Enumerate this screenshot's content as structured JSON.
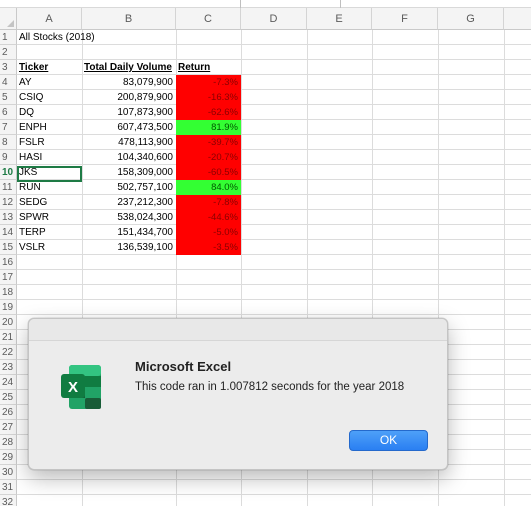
{
  "columns": [
    "A",
    "B",
    "C",
    "D",
    "E",
    "F",
    "G"
  ],
  "rows": [
    "1",
    "2",
    "3",
    "4",
    "5",
    "6",
    "7",
    "8",
    "9",
    "10",
    "11",
    "12",
    "13",
    "14",
    "15",
    "16",
    "17",
    "18",
    "19",
    "20",
    "21",
    "22",
    "23",
    "24",
    "25",
    "26",
    "27",
    "28",
    "29",
    "30",
    "31",
    "32"
  ],
  "sheet": {
    "title": "All Stocks (2018)",
    "headers": {
      "ticker": "Ticker",
      "volume": "Total Daily Volume",
      "return": "Return"
    },
    "data": [
      {
        "ticker": "AY",
        "volume": "83,079,900",
        "return": "-7.3%",
        "status": "negative"
      },
      {
        "ticker": "CSIQ",
        "volume": "200,879,900",
        "return": "-16.3%",
        "status": "negative"
      },
      {
        "ticker": "DQ",
        "volume": "107,873,900",
        "return": "-62.6%",
        "status": "negative"
      },
      {
        "ticker": "ENPH",
        "volume": "607,473,500",
        "return": "81.9%",
        "status": "positive"
      },
      {
        "ticker": "FSLR",
        "volume": "478,113,900",
        "return": "-39.7%",
        "status": "negative"
      },
      {
        "ticker": "HASI",
        "volume": "104,340,600",
        "return": "-20.7%",
        "status": "negative"
      },
      {
        "ticker": "JKS",
        "volume": "158,309,000",
        "return": "-60.5%",
        "status": "negative"
      },
      {
        "ticker": "RUN",
        "volume": "502,757,100",
        "return": "84.0%",
        "status": "positive"
      },
      {
        "ticker": "SEDG",
        "volume": "237,212,300",
        "return": "-7.8%",
        "status": "negative"
      },
      {
        "ticker": "SPWR",
        "volume": "538,024,300",
        "return": "-44.6%",
        "status": "negative"
      },
      {
        "ticker": "TERP",
        "volume": "151,434,700",
        "return": "-5.0%",
        "status": "negative"
      },
      {
        "ticker": "VSLR",
        "volume": "136,539,100",
        "return": "-3.5%",
        "status": "negative"
      }
    ]
  },
  "colors": {
    "positive": "#33ff33",
    "negative": "#ff0000",
    "selection": "#1e7b45"
  },
  "dialog": {
    "title": "Microsoft Excel",
    "message": "This code ran in 1.007812 seconds for the year 2018",
    "ok_label": "OK",
    "icon": "excel-icon",
    "icon_letter": "X"
  }
}
